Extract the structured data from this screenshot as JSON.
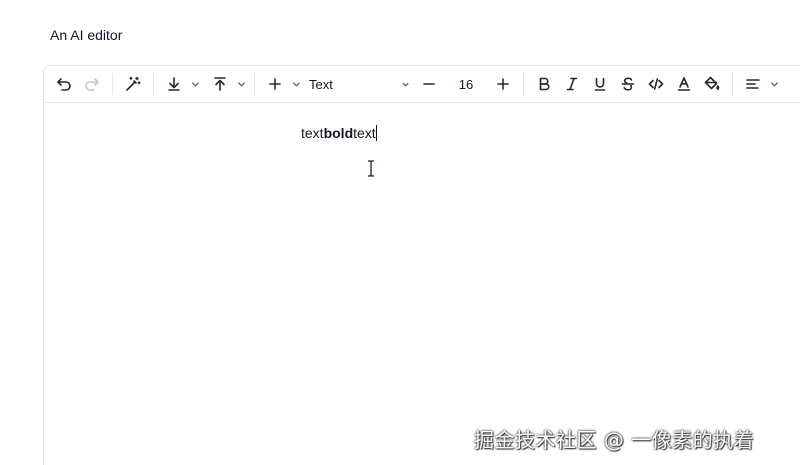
{
  "page": {
    "title": "An AI editor"
  },
  "toolbar": {
    "block_type": "Text",
    "font_size": "16",
    "icons": [
      "undo-icon",
      "redo-icon",
      "magic-wand-icon",
      "download-icon",
      "upload-icon",
      "plus-icon",
      "minus-icon",
      "plus-icon",
      "bold-icon",
      "italic-icon",
      "underline-icon",
      "strikethrough-icon",
      "code-icon",
      "font-color-icon",
      "paint-bucket-icon",
      "align-left-icon"
    ]
  },
  "editor": {
    "text_before": "text",
    "text_bold": "bold",
    "text_after": "text"
  },
  "watermark": "掘金技术社区 @ 一像素的执着"
}
